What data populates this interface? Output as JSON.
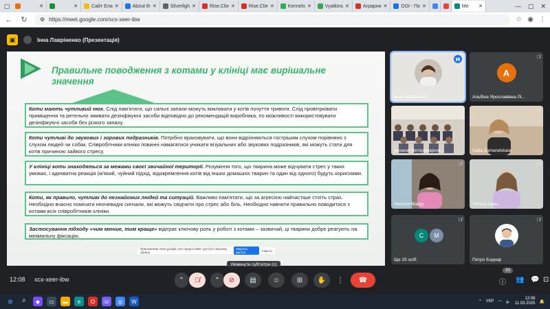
{
  "browser": {
    "tabs": [
      {
        "label": "",
        "color": "#e8710a"
      },
      {
        "label": "",
        "color": "#1e8e3e"
      },
      {
        "label": "Сайт Ела",
        "color": "#fbbc04"
      },
      {
        "label": "About th",
        "color": "#1a73e8"
      },
      {
        "label": "Silverligh",
        "color": "#5f6368"
      },
      {
        "label": "Rise.Clie",
        "color": "#d93025"
      },
      {
        "label": "Rise.Clie",
        "color": "#d93025"
      },
      {
        "label": "Kennels",
        "color": "#34a853"
      },
      {
        "label": "Vyatkins",
        "color": "#34a853"
      },
      {
        "label": "Аграрни",
        "color": "#d93025"
      },
      {
        "label": "DOI - По",
        "color": "#1a73e8"
      },
      {
        "label": "",
        "color": "#4285f4"
      },
      {
        "label": "",
        "color": "#ea4335"
      },
      {
        "label": "Me",
        "color": "#00897b"
      }
    ],
    "url": "https://meet.google.com/xcx-xeer-ibw"
  },
  "meet": {
    "presenter_label": "Інна Лавріненко (Презентація)",
    "clock": "12:08",
    "meeting_code": "xcx-xeer-ibw",
    "participants_count": "33",
    "tooltip": "Увімкнути субтитри (c)",
    "caption_popup": {
      "text": "Приложение meet.google.com предоставит доступ к вашему экрану",
      "share_btn": "Закрыть доступ",
      "hide_btn": "Скрыть"
    }
  },
  "slide": {
    "title": "Правильне поводження з котами у клініці має вирішальне значення",
    "boxes": [
      {
        "lead": "Коти мають чутливий нюх.",
        "text": " Слід пам'ятати, що сильні запахи   можуть викликати у котів почуття тривоги. Слід провітрювати приміщення та ретельно змивати дезінфікуючі засоби відповідно до рекомендацій виробника, по можливості використовувати дезінфікуючі засоби без різкого запаху."
      },
      {
        "lead": "Коти  чутливі до звукових і зорових подразників.",
        "text": " Потрібно враховувати, що вони відрізняються гострішим слухом порівняно з слухом людей чи собак. Співробітники клініки повинні намагатися уникати візуальних або звукових подразників, які можуть стати для котів причиною зайвого стресу."
      },
      {
        "lead": "У клініці коти знаходяться за межами своєї звичайної території.",
        "text": " Розуміння того, що тварина може відчувати стрес у таких умовах, і адекватна реакція (м'який, чуйний підхід, відокремлення котів від інших домашніх тварин та один від одного) будуть корисними."
      },
      {
        "lead": "Коти, як правило, чутливі до незнайомих людей та ситуацій.",
        "text": " Важливо пам'ятати, що за агресією найчастіше стоїть страх. Необхідно вчасно помічати неочевидні сигнали, які можуть свідчити про стрес або біль. Необхідно навчити правильно поводитися з котами всіх співробітників клініки."
      },
      {
        "lead": "Застосування підходу «чим менше, тим краще»",
        "text": " відіграє ключову роль у роботі з котами – зазвичай, ці тварини добре реагують на мінімальну фіксацію."
      }
    ]
  },
  "tiles": [
    {
      "name": "Інна Лавріненко",
      "type": "photo-woman",
      "bg": "#e7e5e1",
      "active": true
    },
    {
      "name": "Альбіна Ярославівна Лі...",
      "initial": "А",
      "av_color": "#e8710a",
      "bg": "#3c4043"
    },
    {
      "name": "деканат Ветеринарної...",
      "type": "photo-room",
      "bg": "#c9c3b8"
    },
    {
      "name": "Galia Zamaratskaia",
      "type": "photo-woman2",
      "bg": "#b9a58e"
    },
    {
      "name": "Наталія Мазур",
      "type": "photo-woman3",
      "bg": "#8a7d72"
    },
    {
      "name": "Тетяна Гава...",
      "type": "photo-woman4",
      "bg": "#c4c8c4"
    },
    {
      "name": "Ще 25 осіб",
      "initials": [
        "С",
        "М"
      ],
      "bg": "#3c4043"
    },
    {
      "name": "Петро Боднар",
      "type": "photo-man",
      "bg": "#3c4043"
    }
  ],
  "taskbar": {
    "lang": "УКР",
    "time": "12:08",
    "date": "11.03.2025"
  }
}
